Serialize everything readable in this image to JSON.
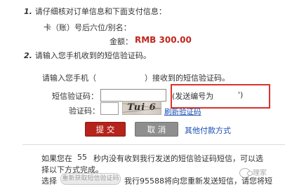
{
  "step1": {
    "number": "1.",
    "title": "请仔细核对订单信息和下面支付信息：",
    "card_label": "卡（账）号后六位/别名：",
    "card_value": "",
    "amount_label": "金额：",
    "amount_value": "RMB 300.00"
  },
  "step2": {
    "number": "2.",
    "title": "请输入您手机收到的短信验证码。",
    "instruction_prefix": "请输入您手机（",
    "instruction_suffix": "）接收到的短信验证码。",
    "sms_label": "短信验证码：",
    "sms_value": "",
    "sms_note": "(发送编号为",
    "sms_note_end": "')",
    "captcha_label": "验证码：",
    "captcha_value": "",
    "captcha_text": "Tui 6",
    "refresh_label": "刷新验证码"
  },
  "actions": {
    "submit_label": "提 交",
    "cancel_label": "取 消",
    "other_payment_label": "其他付款方式"
  },
  "notice": {
    "line1_prefix": "如果您在",
    "countdown": "55",
    "line1_suffix": "秒内没有收到我行发送的短信验证码短信，可以选",
    "line2": "择以下方式完成。",
    "select_label": "选择",
    "resend_button": "重新获取短信验证码",
    "line3": "我行95588将向您重新发送短信，请您将短"
  },
  "watermark": "理家",
  "colors": {
    "brand_red": "#b5231c",
    "amount_red": "#c0261d",
    "link_blue": "#1a4fb5",
    "highlight_border": "#d9332b"
  }
}
